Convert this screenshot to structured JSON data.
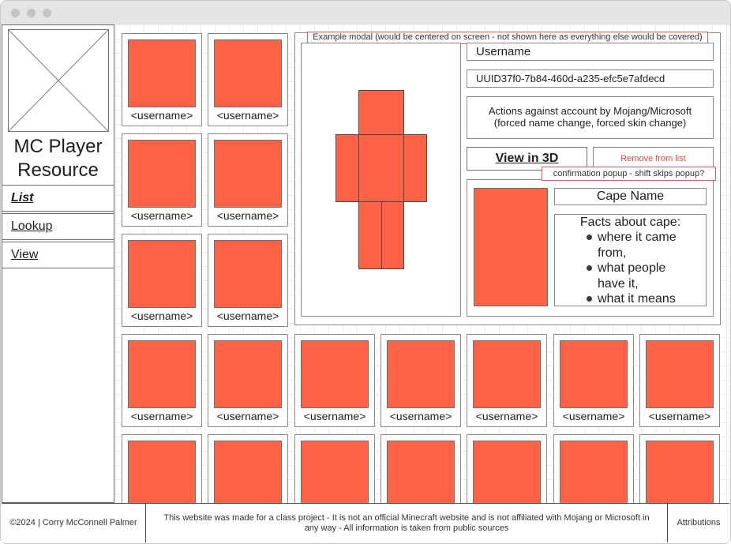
{
  "app": {
    "title": "MC Player Resource"
  },
  "sidebar": {
    "nav": [
      {
        "label": "List",
        "active": true
      },
      {
        "label": "Lookup",
        "active": false
      },
      {
        "label": "View",
        "active": false
      }
    ]
  },
  "cards": {
    "placeholder_label": "<username>",
    "skin_color": "#ff6347"
  },
  "modal": {
    "note": "Example modal (would be centered on screen - not shown here as everything else would be covered)",
    "username": "Username",
    "uuid": "UUID37f0-7b84-460d-a235-efc5e7afdecd",
    "actions_line1": "Actions against account by Mojang/Microsoft",
    "actions_line2": "(forced name change, forced skin change)",
    "view3d_label": "View in 3D",
    "remove_label": "Remove from list",
    "confirm_note": "confirmation popup - shift skips popup?",
    "cape": {
      "name": "Cape Name",
      "facts_heading": "Facts about cape:",
      "facts": [
        "where it came from,",
        "what people have it,",
        "what it means"
      ]
    }
  },
  "footer": {
    "copyright": "©2024 | Corry McConnell Palmer",
    "disclaimer": "This website was made for a class project - It is not an official Minecraft website and is not affiliated with Mojang or Microsoft in any way - All information is taken from public sources",
    "attributions": "Attributions"
  },
  "colors": {
    "accent": "#ff6347",
    "note_border": "#e25a5a",
    "remove_text": "#e0463a"
  }
}
